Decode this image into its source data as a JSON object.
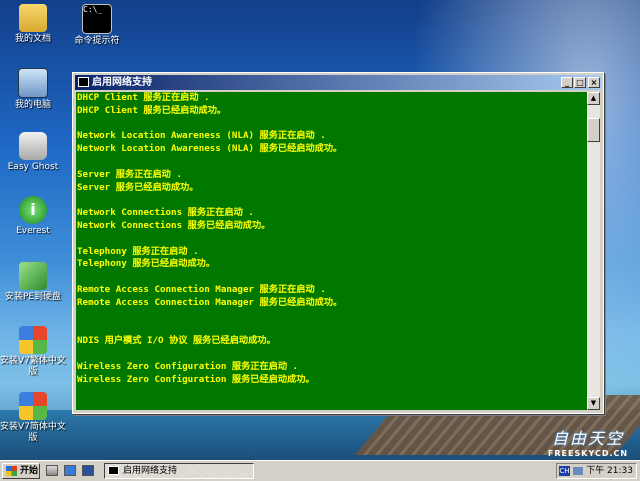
{
  "desktop": {
    "icons": [
      {
        "label": "我的文档",
        "icon": "folder-icon"
      },
      {
        "label": "命令提示符",
        "icon": "cmd-icon"
      },
      {
        "label": "我的电脑",
        "icon": "computer-icon"
      },
      {
        "label": "Easy Ghost",
        "icon": "ghost-disk-icon"
      },
      {
        "label": "Everest",
        "icon": "info-icon"
      },
      {
        "label": "安装PE到硬盘",
        "icon": "install-pe-icon"
      },
      {
        "label": "安装V7繁体中文版",
        "icon": "windows-icon"
      },
      {
        "label": "安装V7简体中文版",
        "icon": "windows-icon"
      }
    ]
  },
  "window": {
    "title": "启用网络支持",
    "buttons": {
      "minimize": "_",
      "maximize": "□",
      "close": "×"
    },
    "console_lines": [
      "DHCP Client 服务正在启动 .",
      "DHCP Client 服务已经启动成功。",
      "",
      "Network Location Awareness (NLA) 服务正在启动 .",
      "Network Location Awareness (NLA) 服务已经启动成功。",
      "",
      "Server 服务正在启动 .",
      "Server 服务已经启动成功。",
      "",
      "Network Connections 服务正在启动 .",
      "Network Connections 服务已经启动成功。",
      "",
      "Telephony 服务正在启动 .",
      "Telephony 服务已经启动成功。",
      "",
      "Remote Access Connection Manager 服务正在启动 .",
      "Remote Access Connection Manager 服务已经启动成功。",
      "",
      "",
      "NDIS 用户模式 I/O 协议 服务已经启动成功。",
      "",
      "Wireless Zero Configuration 服务正在启动 .",
      "Wireless Zero Configuration 服务已经启动成功。"
    ],
    "scrollbar": {
      "up": "▲",
      "down": "▼"
    }
  },
  "taskbar": {
    "start_label": "开始",
    "task_label": "启用网络支持",
    "tray": {
      "lang": "CH",
      "time": "下午 21:33"
    }
  },
  "watermark": {
    "title": "自由天空",
    "url": "FREESKYCD.CN"
  },
  "colors": {
    "console_bg": "#007800",
    "console_text": "#ffff00"
  }
}
